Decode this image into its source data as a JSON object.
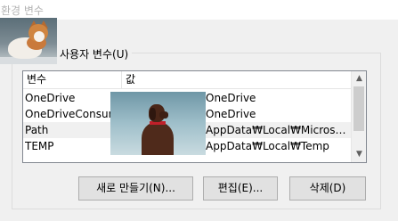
{
  "window": {
    "title": "환경 변수"
  },
  "user_vars": {
    "group_label": "사용자 변수(U)",
    "columns": {
      "name": "변수",
      "value": "값"
    },
    "rows": [
      {
        "name": "OneDrive",
        "value": "OneDrive"
      },
      {
        "name": "OneDriveConsume",
        "value": "OneDrive"
      },
      {
        "name": "Path",
        "value": "AppData₩Local₩Microsoft..."
      },
      {
        "name": "TEMP",
        "value": "AppData₩Local₩Temp"
      }
    ],
    "buttons": {
      "new": "새로 만들기(N)...",
      "edit": "편집(E)...",
      "delete": "삭제(D)"
    }
  },
  "scrollbar": {
    "up": "▲",
    "down": "▼"
  }
}
